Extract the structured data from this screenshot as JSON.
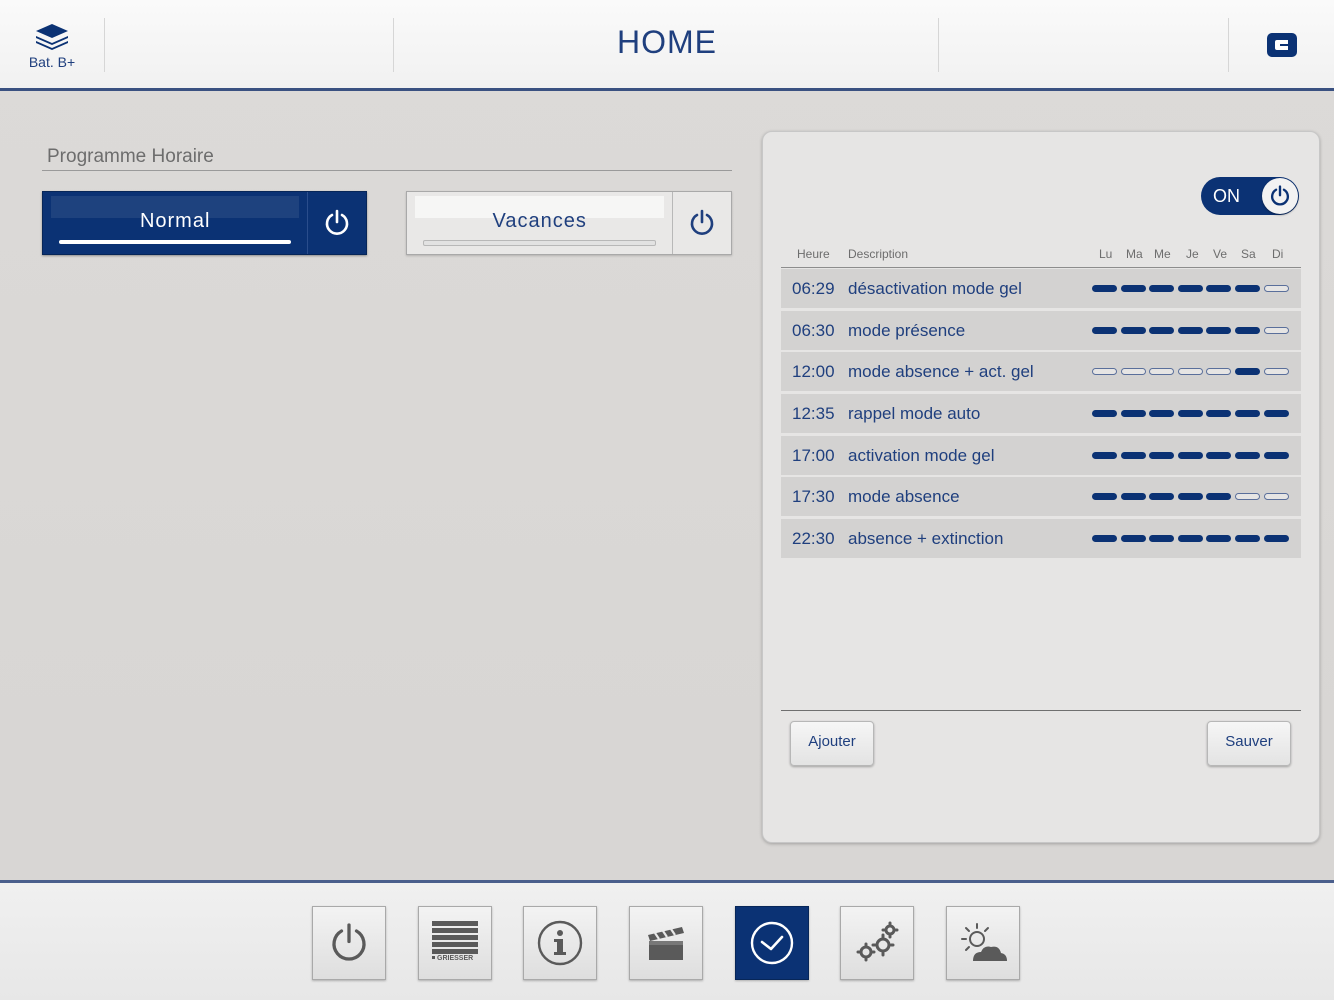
{
  "header": {
    "building_label": "Bat. B+",
    "title": "HOME"
  },
  "left": {
    "section_title": "Programme Horaire",
    "modes": [
      {
        "label": "Normal",
        "active": true
      },
      {
        "label": "Vacances",
        "active": false
      }
    ]
  },
  "schedule": {
    "toggle_label": "ON",
    "columns": {
      "time": "Heure",
      "description": "Description",
      "days": [
        "Lu",
        "Ma",
        "Me",
        "Je",
        "Ve",
        "Sa",
        "Di"
      ]
    },
    "rows": [
      {
        "time": "06:29",
        "description": "désactivation mode gel",
        "days": [
          1,
          1,
          1,
          1,
          1,
          1,
          0
        ]
      },
      {
        "time": "06:30",
        "description": "mode présence",
        "days": [
          1,
          1,
          1,
          1,
          1,
          1,
          0
        ]
      },
      {
        "time": "12:00",
        "description": "mode absence + act. gel",
        "days": [
          0,
          0,
          0,
          0,
          0,
          1,
          0
        ]
      },
      {
        "time": "12:35",
        "description": "rappel mode auto",
        "days": [
          1,
          1,
          1,
          1,
          1,
          1,
          1
        ]
      },
      {
        "time": "17:00",
        "description": "activation mode gel",
        "days": [
          1,
          1,
          1,
          1,
          1,
          1,
          1
        ]
      },
      {
        "time": "17:30",
        "description": "mode absence",
        "days": [
          1,
          1,
          1,
          1,
          1,
          0,
          0
        ]
      },
      {
        "time": "22:30",
        "description": "absence + extinction",
        "days": [
          1,
          1,
          1,
          1,
          1,
          1,
          1
        ]
      }
    ],
    "add_label": "Ajouter",
    "save_label": "Sauver"
  },
  "bottom_nav": {
    "items": [
      {
        "icon": "power-icon",
        "active": false
      },
      {
        "icon": "blinds-icon",
        "active": false,
        "brand_text": "GRIESSER"
      },
      {
        "icon": "info-icon",
        "active": false
      },
      {
        "icon": "scene-clapper-icon",
        "active": false
      },
      {
        "icon": "clock-icon",
        "active": true
      },
      {
        "icon": "gears-icon",
        "active": false
      },
      {
        "icon": "weather-icon",
        "active": false
      }
    ]
  },
  "colors": {
    "primary": "#0b3274",
    "text": "#1f3f7e",
    "background": "#dcdad8",
    "panel": "#e6e5e4"
  }
}
